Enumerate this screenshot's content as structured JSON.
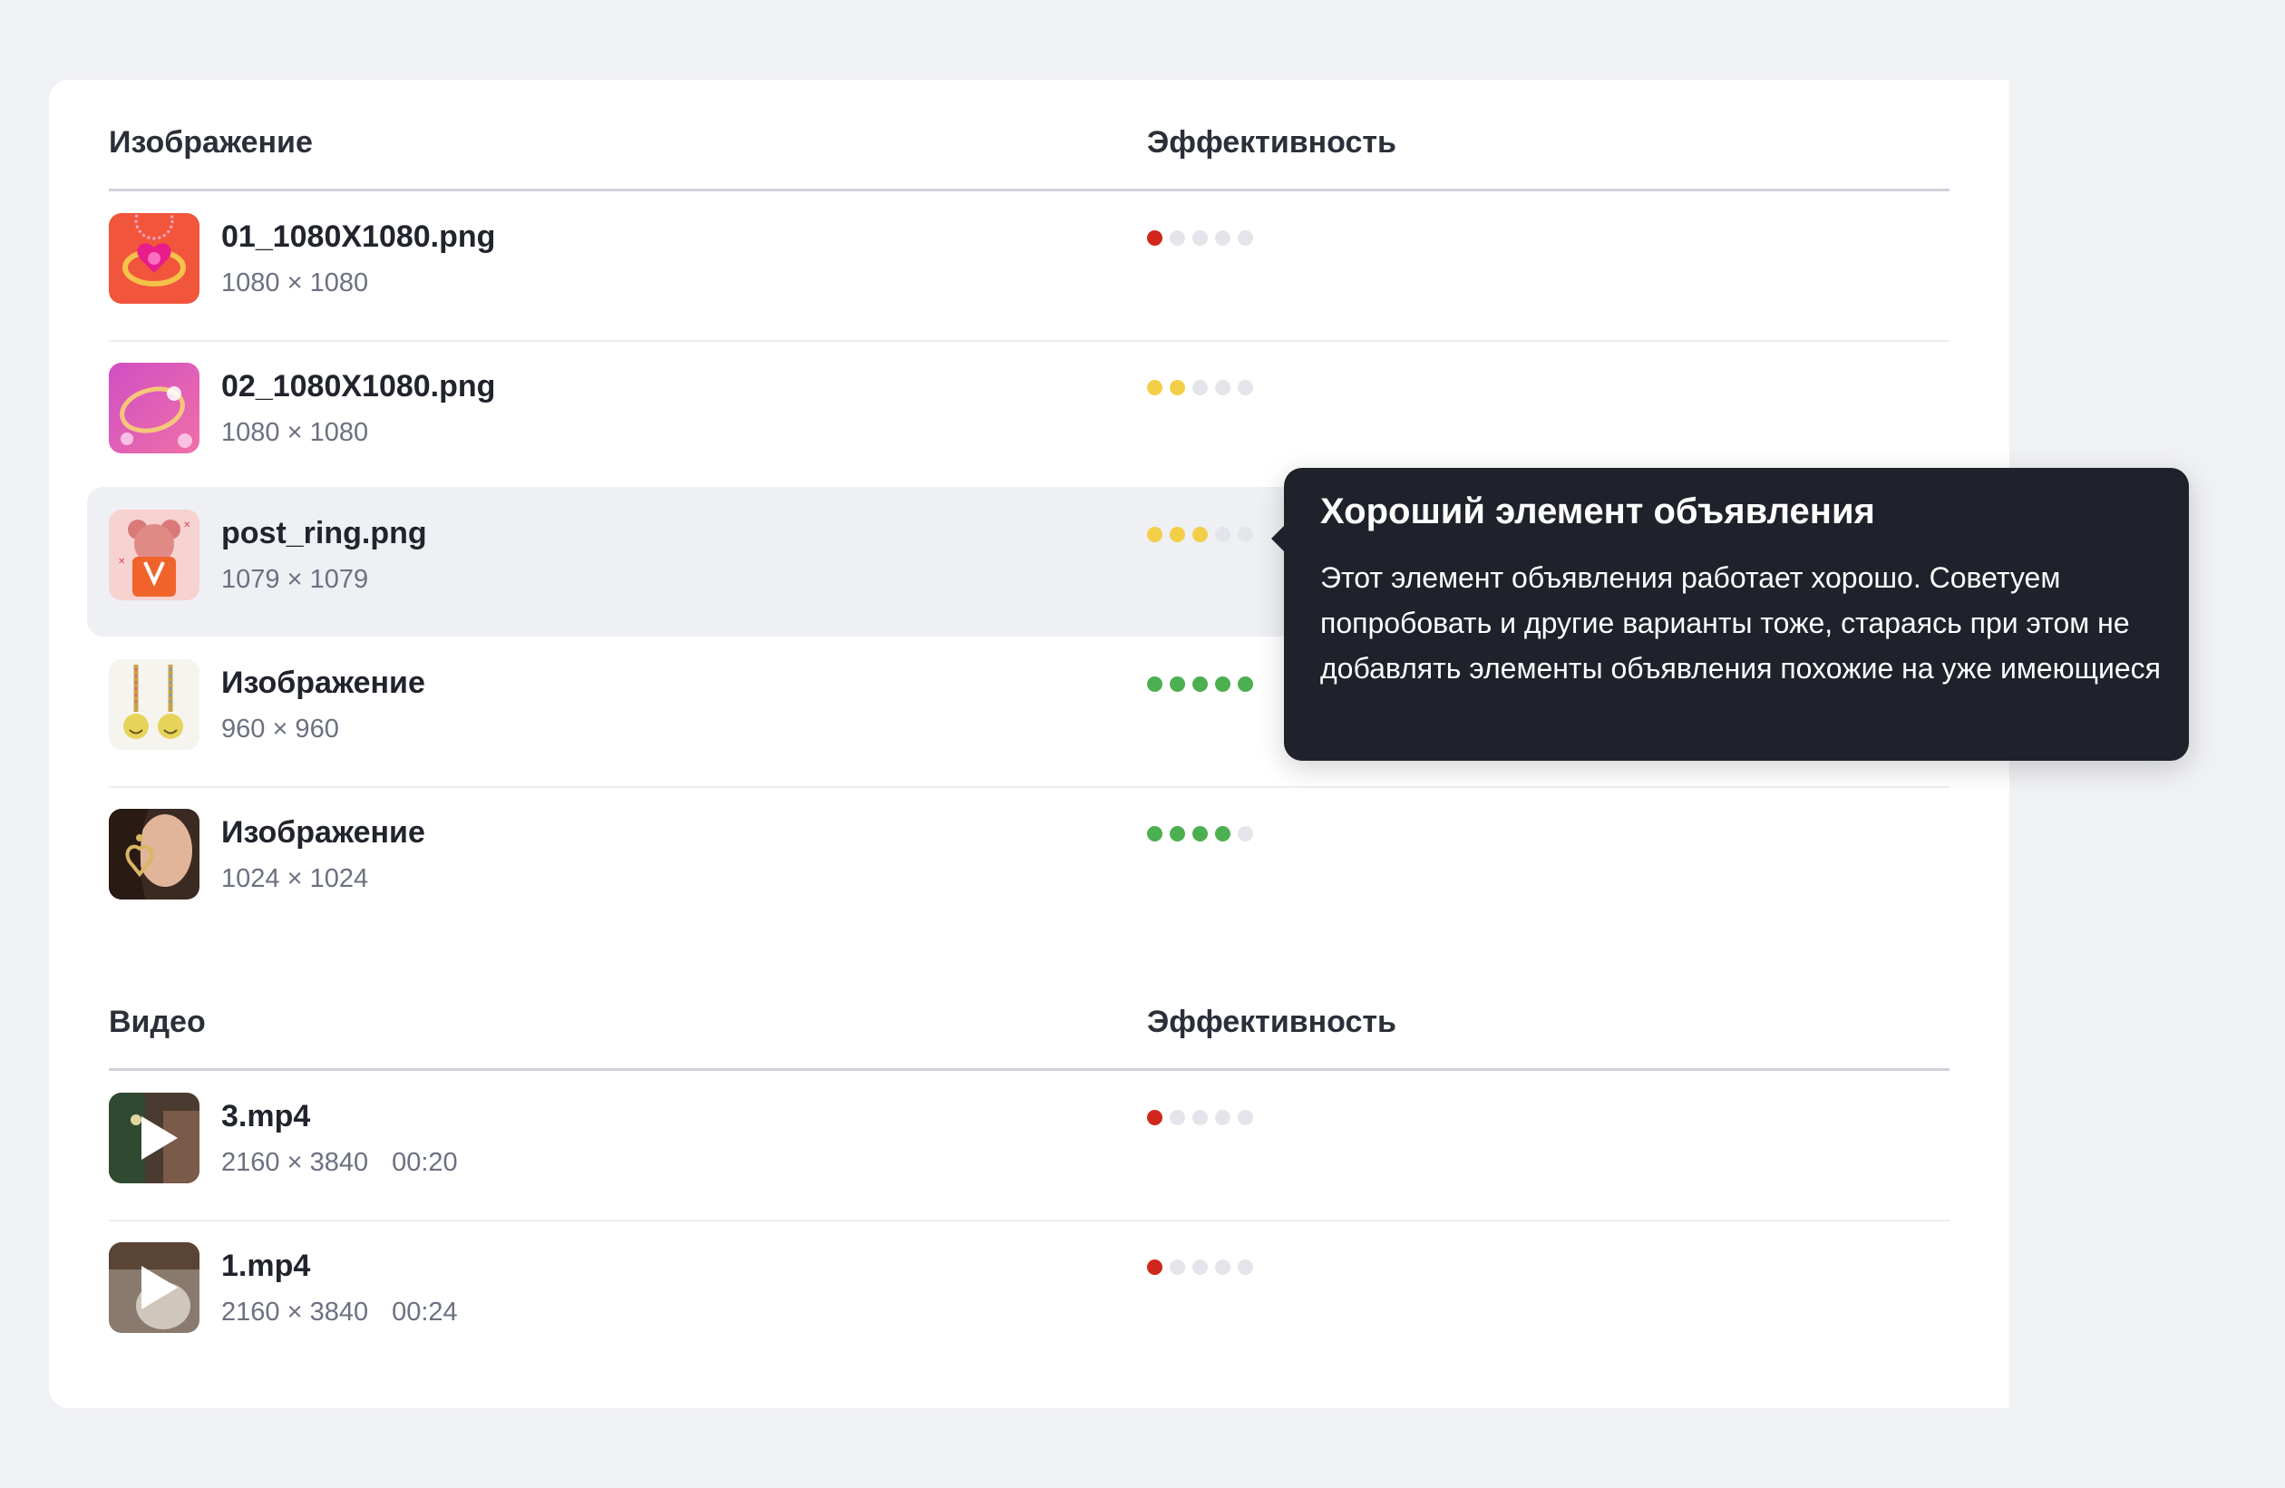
{
  "colors": {
    "red": "#d0271d",
    "yellow": "#f3cf47",
    "green": "#4caf50",
    "empty": "#e3e5ea"
  },
  "images_section": {
    "title": "Изображение",
    "effectiveness_label": "Эффективность",
    "rows": [
      {
        "name": "01_1080X1080.png",
        "size": "1080 × 1080",
        "rating": 1,
        "rating_color": "red",
        "thumb": "pink-ring-thumbnail"
      },
      {
        "name": "02_1080X1080.png",
        "size": "1080 × 1080",
        "rating": 2,
        "rating_color": "yellow",
        "thumb": "ring-magenta-thumbnail"
      },
      {
        "name": "post_ring.png",
        "size": "1079 × 1079",
        "rating": 3,
        "rating_color": "yellow",
        "thumb": "teddy-bear-thumbnail"
      },
      {
        "name": "Изображение",
        "size": "960 × 960",
        "rating": 5,
        "rating_color": "green",
        "thumb": "smiley-earrings-thumbnail"
      },
      {
        "name": "Изображение",
        "size": "1024 × 1024",
        "rating": 4,
        "rating_color": "green",
        "thumb": "woman-earring-thumbnail"
      }
    ]
  },
  "video_section": {
    "title": "Видео",
    "effectiveness_label": "Эффективность",
    "rows": [
      {
        "name": "3.mp4",
        "size": "2160 × 3840",
        "duration": "00:20",
        "rating": 1,
        "rating_color": "red",
        "thumb": "video-play-thumbnail"
      },
      {
        "name": "1.mp4",
        "size": "2160 × 3840",
        "duration": "00:24",
        "rating": 1,
        "rating_color": "red",
        "thumb": "video-play-thumbnail"
      }
    ]
  },
  "tooltip": {
    "title": "Хороший элемент объявления",
    "body": "Этот элемент объявления работает хорошо. Советуем попробовать и другие варианты тоже, стараясь при этом не добавлять элементы объявления похожие на уже имеющиеся"
  }
}
